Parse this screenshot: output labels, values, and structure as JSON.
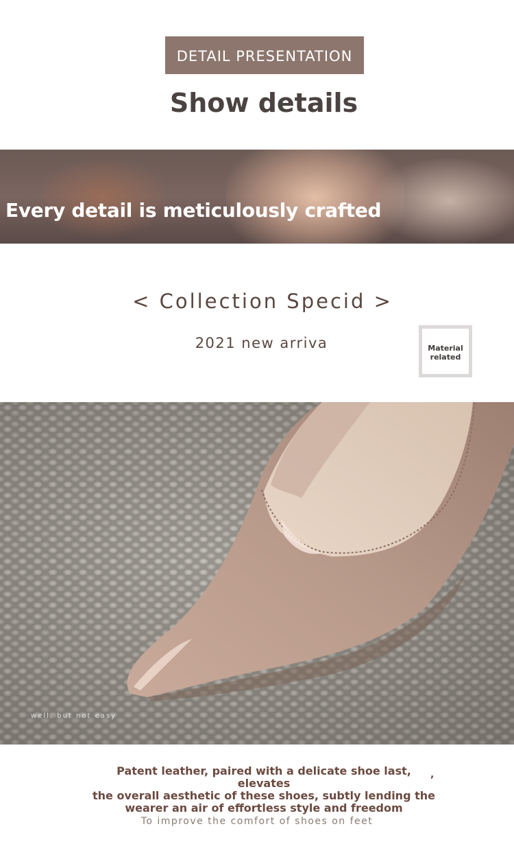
{
  "header": {
    "badge": "DETAIL PRESENTATION",
    "title": "Show details"
  },
  "banner": {
    "caption": "Every detail is meticulously crafted"
  },
  "collection": {
    "heading": "< Collection Specid >",
    "subheading": "2021 new arriva",
    "material_box": {
      "line1": "Material",
      "line2": "related"
    }
  },
  "photo": {
    "watermark": "well, but not easy"
  },
  "footer": {
    "description_line1": "Patent leather, paired with a delicate shoe last, elevates",
    "description_line2": "the overall aesthetic of these shoes, subtly lending the",
    "description_line3": "wearer an air of effortless style and freedom",
    "stray_mark": ",",
    "note": "To improve the comfort of shoes on feet"
  },
  "colors": {
    "badge_bg": "#8c766d",
    "shoe": "#b89a8c",
    "text_brown": "#6b4a40"
  }
}
